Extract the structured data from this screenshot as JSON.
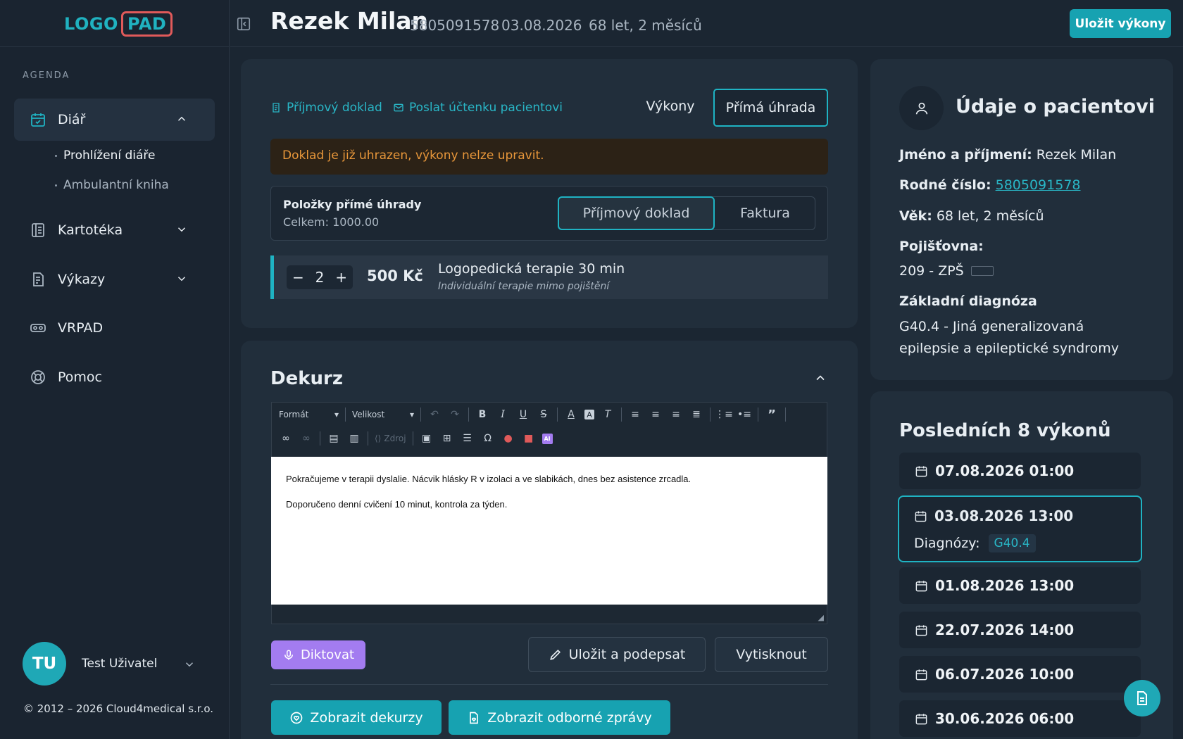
{
  "app": {
    "logo_left": "LOGO",
    "logo_right": "PAD"
  },
  "sidebar": {
    "section": "AGENDA",
    "items": [
      {
        "label": "Diář"
      },
      {
        "label": "Kartotéka"
      },
      {
        "label": "Výkazy"
      },
      {
        "label": "VRPAD"
      },
      {
        "label": "Pomoc"
      }
    ],
    "subitems": [
      {
        "label": "Prohlížení diáře"
      },
      {
        "label": "Ambulantní kniha"
      }
    ],
    "user": {
      "initials": "TU",
      "name": "Test Uživatel"
    },
    "copyright": "© 2012 – 2026 Cloud4medical s.r.o."
  },
  "header": {
    "patient_name": "Rezek Milan",
    "birth_number": "5805091578",
    "date": "03.08.2026",
    "age": "68 let, 2 měsíců",
    "save_button": "Uložit výkony"
  },
  "payment": {
    "link_receipt": "Příjmový doklad",
    "link_send": "Poslat účtenku pacientovi",
    "tab_services": "Výkony",
    "tab_direct": "Přímá úhrada",
    "alert": "Doklad je již uhrazen, výkony nelze upravit.",
    "items_title": "Položky přímé úhrady",
    "items_total": "Celkem: 1000.00",
    "seg_receipt": "Příjmový doklad",
    "seg_invoice": "Faktura",
    "item": {
      "qty": "2",
      "minus": "−",
      "plus": "+",
      "price": "500 Kč",
      "name": "Logopedická terapie 30 min",
      "desc": "Individuální terapie mimo pojištění"
    }
  },
  "dekurz": {
    "title": "Dekurz",
    "format": "Formát",
    "size": "Velikost",
    "source": "Zdroj",
    "text_1": "Pokračujeme v terapii dyslalie. Nácvik hlásky R v izolaci a ve slabikách, dnes bez asistence zrcadla.",
    "text_2": "Doporučeno denní cvičení 10 minut, kontrola za týden.",
    "dictate": "Diktovat",
    "save_sign": "Uložit a podepsat",
    "print": "Vytisknout",
    "show_dekurzy": "Zobrazit dekurzy",
    "show_reports": "Zobrazit odborné zprávy"
  },
  "patient_info": {
    "title": "Údaje o pacientovi",
    "name_label": "Jméno a příjmení:",
    "name_value": "Rezek Milan",
    "rc_label": "Rodné číslo:",
    "rc_value": "5805091578",
    "age_label": "Věk:",
    "age_value": "68 let, 2 měsíců",
    "insurance_label": "Pojišťovna:",
    "insurance_value": "209 - ZPŠ",
    "diagnosis_label": "Základní diagnóza",
    "diagnosis_line1": "G40.4 - Jiná generalizovaná",
    "diagnosis_line2": "epilepsie a epileptické syndromy"
  },
  "recent": {
    "title": "Posledních 8 výkonů",
    "diagnoses_label": "Diagnózy:",
    "diagnosis_badge": "G40.4",
    "visits": [
      "07.08.2026 01:00",
      "03.08.2026 13:00",
      "01.08.2026 13:00",
      "22.07.2026 14:00",
      "06.07.2026 10:00",
      "30.06.2026 06:00"
    ]
  },
  "colors": {
    "accent": "#17a2b1",
    "background": "#1b2632",
    "card": "#212e3b",
    "alert_text": "#e8973a",
    "dictate": "#a37cf0"
  }
}
